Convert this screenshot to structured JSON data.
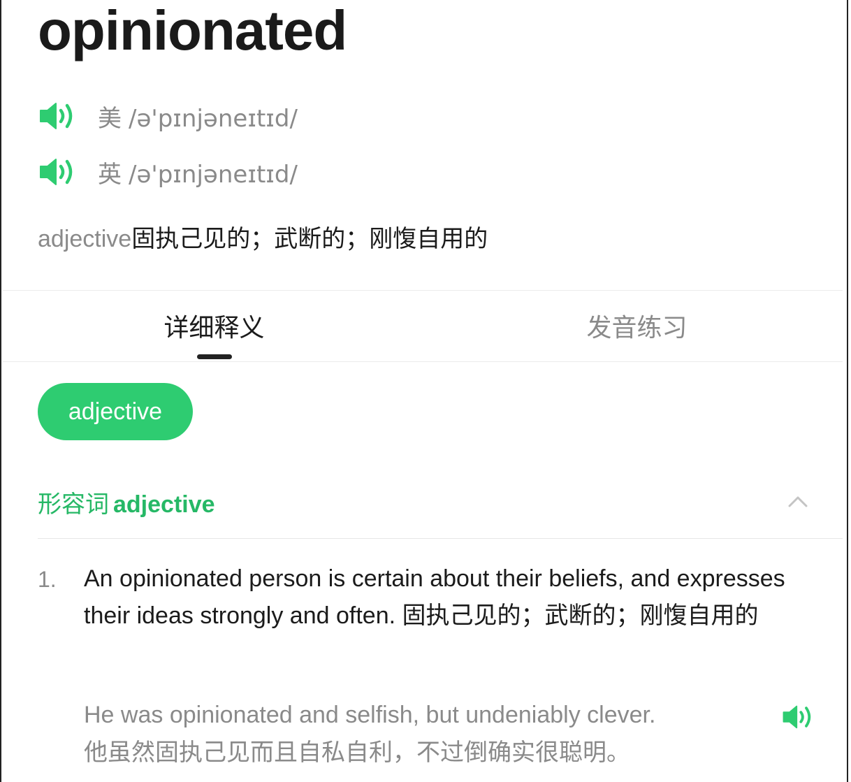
{
  "entry": {
    "word": "opinionated",
    "pronunciations": [
      {
        "region": "美",
        "ipa": "/ə'pɪnjəneɪtɪd/",
        "icon": "speaker-icon"
      },
      {
        "region": "英",
        "ipa": "/ə'pɪnjəneɪtɪd/",
        "icon": "speaker-icon"
      }
    ],
    "brief": {
      "pos": "adjective",
      "meaning": "固执己见的；武断的；刚愎自用的"
    }
  },
  "tabs": [
    {
      "label": "详细释义",
      "active": true
    },
    {
      "label": "发音练习",
      "active": false
    }
  ],
  "pos_chip": "adjective",
  "section": {
    "cn": "形容词",
    "en": "adjective",
    "icon": "chevron-up-icon"
  },
  "definitions": [
    {
      "num": "1.",
      "text": "An opinionated person is certain about their beliefs, and expresses their ideas strongly and often. 固执己见的；武断的；刚愎自用的",
      "example": {
        "en": "He was opinionated and selfish, but undeniably clever.",
        "cn": "他虽然固执己见而且自私自利，不过倒确实很聪明。",
        "icon": "speaker-icon"
      }
    }
  ],
  "colors": {
    "accent": "#2ecc71",
    "accent_text": "#26b866",
    "muted_text": "#8a8a8a",
    "primary_text": "#1b1b1b"
  }
}
